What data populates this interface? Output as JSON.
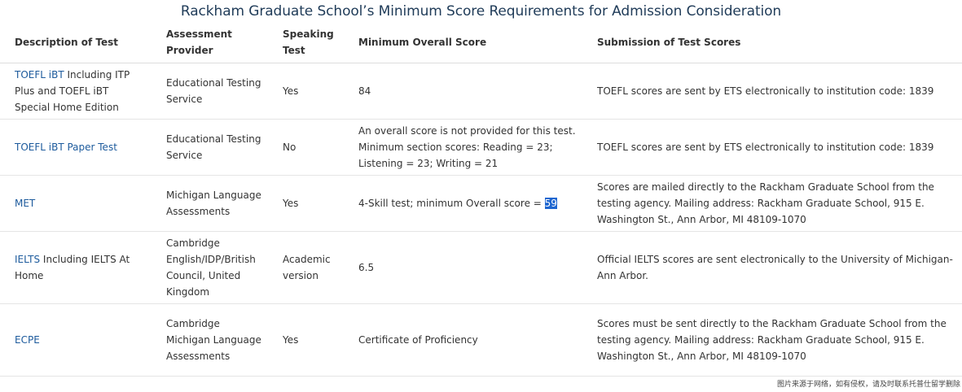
{
  "caption": "Rackham Graduate School’s Minimum Score Requirements for Admission Consideration",
  "headers": {
    "test": "Description of Test",
    "provider": "Assessment Provider",
    "speaking": "Speaking Test",
    "minimum": "Minimum Overall Score",
    "submission": "Submission of Test Scores"
  },
  "rows": [
    {
      "test_link": "TOEFL iBT",
      "test_rest": " Including ITP Plus and TOEFL iBT Special Home Edition",
      "provider": "Educational Testing Service",
      "speaking": "Yes",
      "minimum": "84",
      "submission": "TOEFL scores are sent by ETS electronically to institution code: 1839"
    },
    {
      "test_link": "TOEFL iBT Paper Test",
      "test_rest": "",
      "provider": "Educational Testing Service",
      "speaking": "No",
      "minimum": "An overall score is not provided for this test. Minimum section scores: Reading = 23; Listening = 23; Writing = 21",
      "submission": "TOEFL scores are sent by ETS electronically to institution code: 1839"
    },
    {
      "test_link": "MET",
      "test_rest": "",
      "provider": "Michigan Language Assessments",
      "speaking": "Yes",
      "minimum_prefix": "4-Skill test; minimum Overall score = ",
      "minimum_highlight": "59",
      "submission": "Scores are mailed directly to the Rackham Graduate School from the testing agency. Mailing address: Rackham Graduate School, 915 E. Washington St., Ann Arbor, MI 48109-1070"
    },
    {
      "test_link": "IELTS",
      "test_rest": " Including IELTS At Home",
      "provider": "Cambridge English/IDP/British Council, United Kingdom",
      "speaking": "Academic version",
      "minimum": "6.5",
      "submission": "Official IELTS scores are sent electronically to the University of Michigan-Ann Arbor."
    },
    {
      "test_link": "ECPE",
      "test_rest": "",
      "provider": "Cambridge Michigan Language Assessments",
      "speaking": "Yes",
      "minimum": "Certificate of Proficiency",
      "submission": "Scores must be sent directly to the Rackham Graduate School from the testing agency. Mailing address: Rackham Graduate School, 915 E. Washington St., Ann Arbor, MI 48109-1070"
    }
  ],
  "watermark": "图片来源于网络，如有侵权，请及时联系托普仕留学删除"
}
